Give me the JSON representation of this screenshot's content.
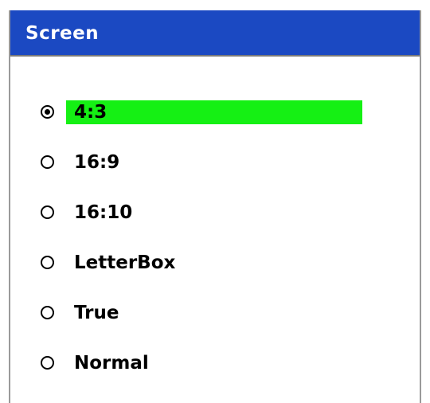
{
  "menu": {
    "title": "Screen",
    "title_bar_color": "#1b49c2",
    "highlight_color": "#15f014",
    "selected_index": 0,
    "options": [
      {
        "label": "4:3",
        "selected": true
      },
      {
        "label": "16:9",
        "selected": false
      },
      {
        "label": "16:10",
        "selected": false
      },
      {
        "label": "LetterBox",
        "selected": false
      },
      {
        "label": "True",
        "selected": false
      },
      {
        "label": "Normal",
        "selected": false
      }
    ]
  }
}
